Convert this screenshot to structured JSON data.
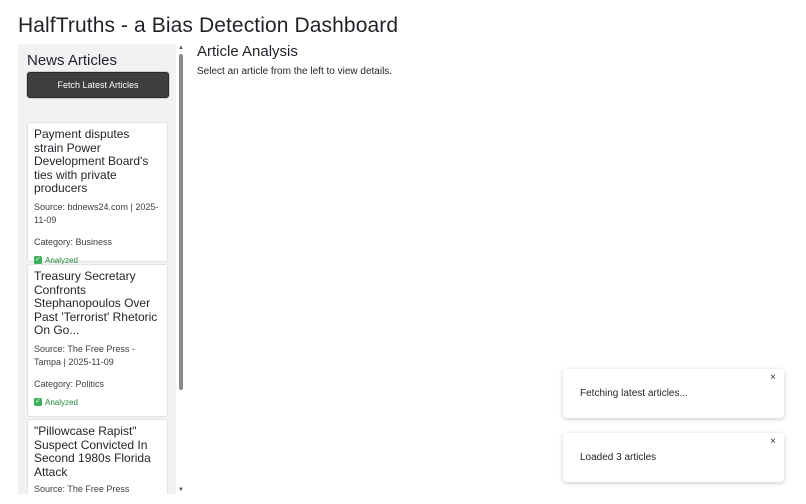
{
  "app": {
    "title": "HalfTruths - a Bias Detection Dashboard"
  },
  "sidebar": {
    "title": "News Articles",
    "fetch_button": "Fetch Latest Articles",
    "articles": [
      {
        "title": "Payment disputes strain Power Development Board's ties with private producers",
        "meta": "Source: bdnews24.com | 2025-11-09",
        "category": "Category: Business",
        "status": "Analyzed"
      },
      {
        "title": "Treasury Secretary Confronts Stephanopoulos Over Past 'Terrorist' Rhetoric On Go...",
        "meta": "Source: The Free Press - Tampa | 2025-11-09",
        "category": "Category: Politics",
        "status": "Analyzed"
      },
      {
        "title": "\"Pillowcase Rapist\" Suspect Convicted In Second 1980s Florida Attack",
        "meta": "Source: The Free Press"
      }
    ]
  },
  "analysis": {
    "title": "Article Analysis",
    "hint": "Select an article from the left to view details."
  },
  "toasts": [
    {
      "text": "Fetching latest articles...",
      "close": "×"
    },
    {
      "text": "Loaded 3 articles",
      "close": "×"
    }
  ],
  "icons": {
    "check": "✓",
    "scroll_up": "▲",
    "scroll_down": "▼"
  },
  "colors": {
    "button_bg": "#3e3e3e",
    "analyzed_green": "#1f8a3a",
    "sidebar_bg": "#f2f2f4"
  }
}
